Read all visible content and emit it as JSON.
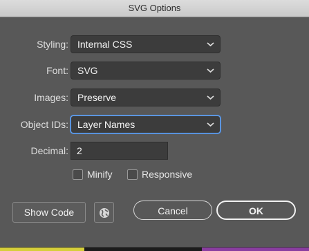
{
  "dialog": {
    "title": "SVG Options"
  },
  "fields": {
    "styling": {
      "label": "Styling:",
      "value": "Internal CSS"
    },
    "font": {
      "label": "Font:",
      "value": "SVG"
    },
    "images": {
      "label": "Images:",
      "value": "Preserve"
    },
    "object_ids": {
      "label": "Object IDs:",
      "value": "Layer Names"
    },
    "decimal": {
      "label": "Decimal:",
      "value": "2"
    }
  },
  "checkboxes": {
    "minify": {
      "label": "Minify",
      "checked": false
    },
    "responsive": {
      "label": "Responsive",
      "checked": false
    }
  },
  "buttons": {
    "show_code": "Show Code",
    "globe_icon": "globe-icon",
    "cancel": "Cancel",
    "ok": "OK"
  },
  "colors": {
    "dialog_bg": "#585858",
    "focus_ring": "#4a86d6"
  }
}
